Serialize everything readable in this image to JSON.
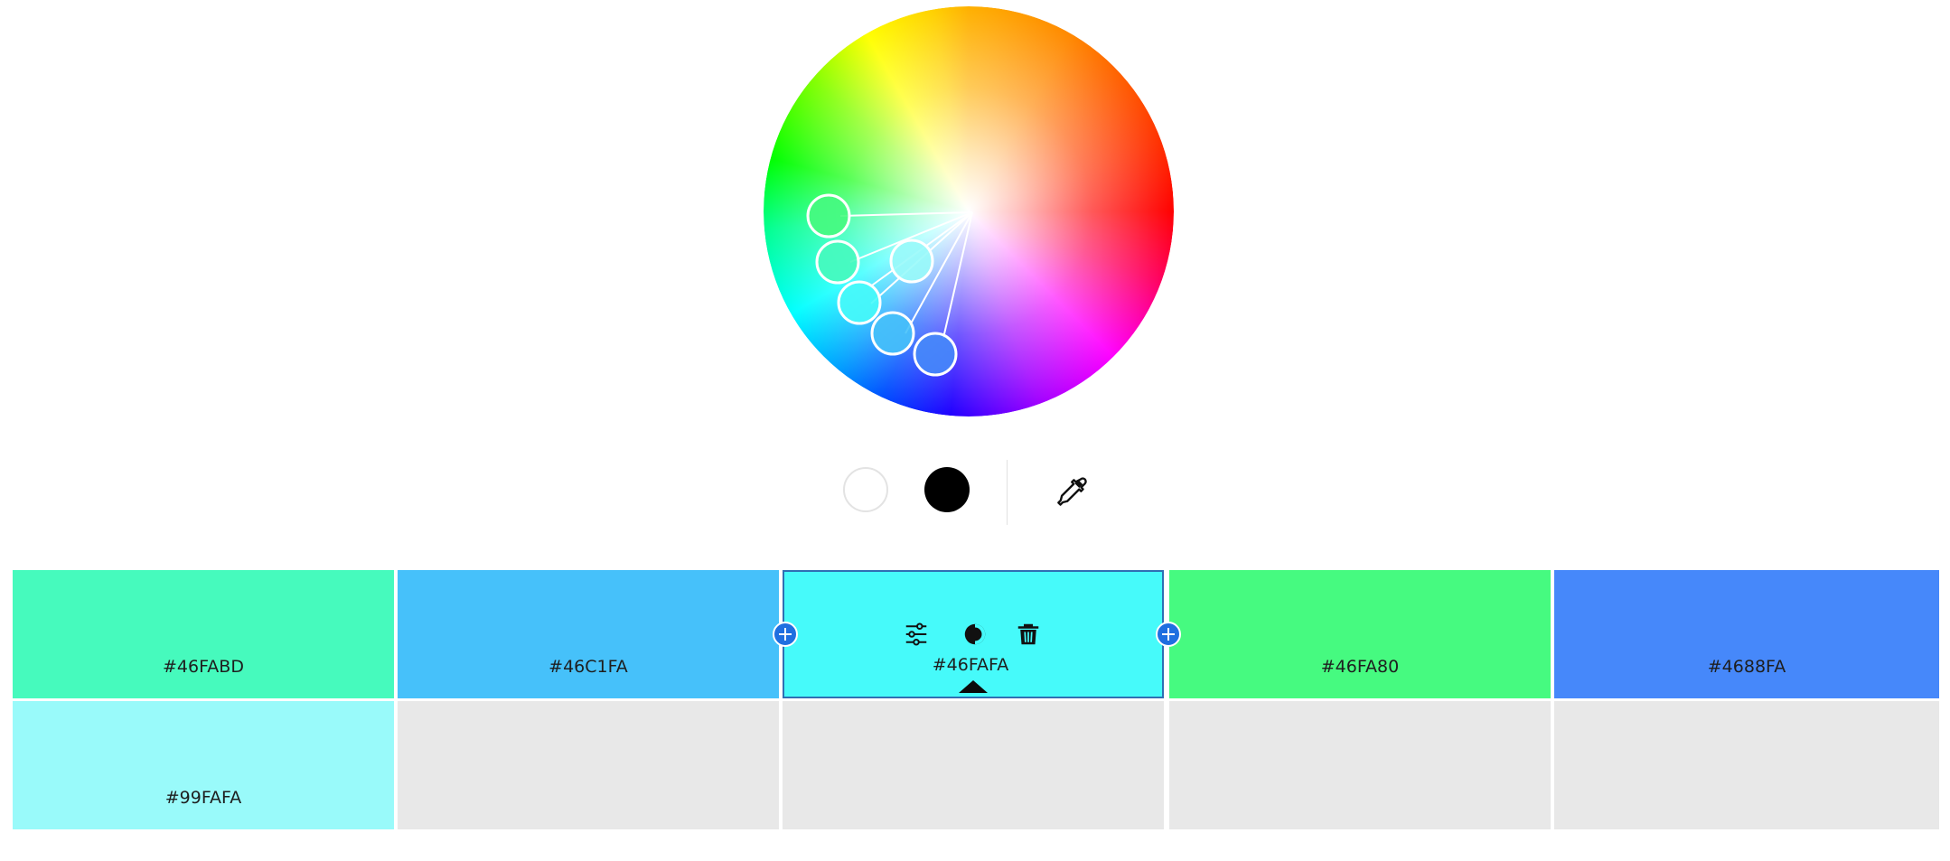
{
  "colors": {
    "handle_1": "#46FA80",
    "handle_2": "#46FABD",
    "handle_3": "#99FAFA",
    "handle_4": "#46FAFA",
    "handle_5": "#46C1FA",
    "handle_6": "#4688FA"
  },
  "toolbar": {
    "white_icon": "white-circle",
    "black_icon": "black-circle",
    "eyedropper_icon": "eyedropper"
  },
  "swatches": [
    {
      "hex": "#46FABD",
      "color": "#46FABD"
    },
    {
      "hex": "#46C1FA",
      "color": "#46C1FA"
    },
    {
      "hex": "#46FAFA",
      "color": "#46FAFA",
      "selected": true
    },
    {
      "hex": "#46FA80",
      "color": "#46FA80"
    },
    {
      "hex": "#4688FA",
      "color": "#4688FA"
    },
    {
      "hex": "#99FAFA",
      "color": "#99FAFA"
    }
  ],
  "swatch_tools": {
    "adjust_icon": "sliders-icon",
    "contrast_icon": "contrast-icon",
    "delete_icon": "trash-icon",
    "add_icon": "plus-icon"
  }
}
